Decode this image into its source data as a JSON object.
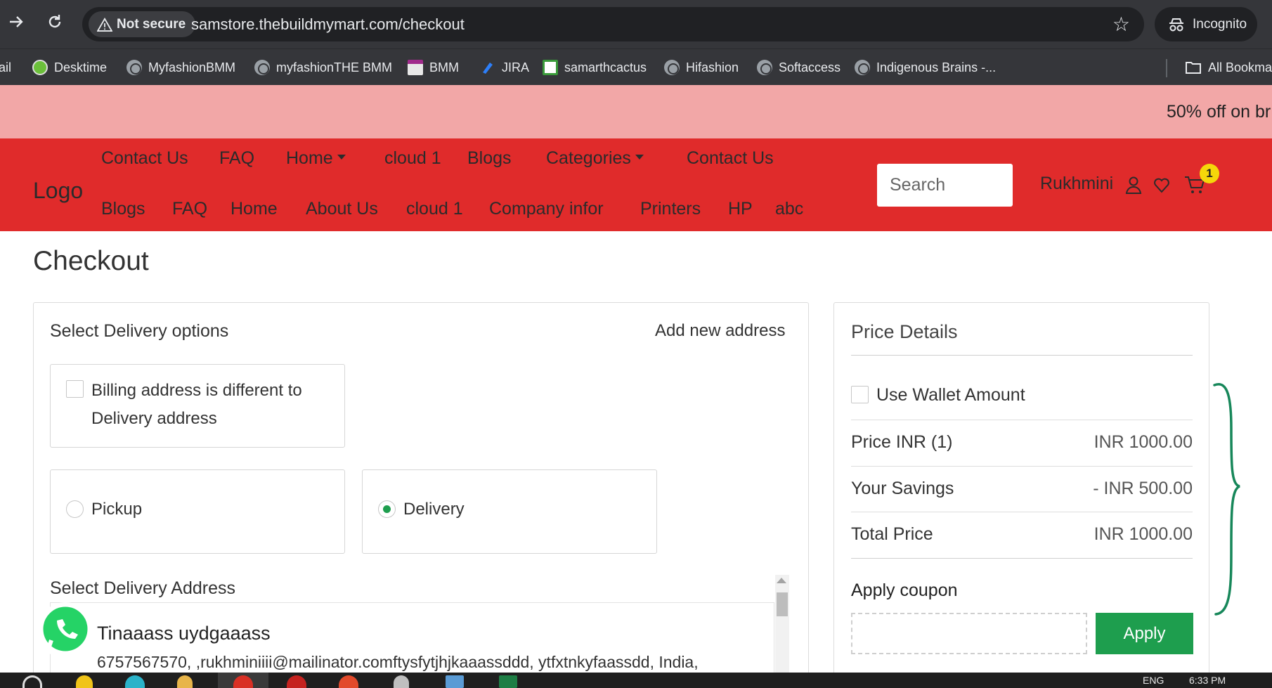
{
  "browser": {
    "security_label": "Not secure",
    "url": "samstore.thebuildmymart.com/checkout",
    "incognito_label": "Incognito",
    "bookmarks": [
      {
        "label": "lail"
      },
      {
        "label": "Desktime"
      },
      {
        "label": "MyfashionBMM"
      },
      {
        "label": "myfashionTHE BMM"
      },
      {
        "label": "BMM"
      },
      {
        "label": "JIRA"
      },
      {
        "label": "samarthcactus"
      },
      {
        "label": "Hifashion"
      },
      {
        "label": "Softaccess"
      },
      {
        "label": "Indigenous Brains -..."
      }
    ],
    "all_bookmarks_label": "All Bookma"
  },
  "promo": {
    "text": "50% off on br",
    "bg_color": "#f2a7a7"
  },
  "header": {
    "bg_color": "#e02b2b",
    "logo": "Logo",
    "menu_top": [
      {
        "label": "Contact Us",
        "dropdown": false
      },
      {
        "label": "FAQ",
        "dropdown": false
      },
      {
        "label": "Home",
        "dropdown": true
      },
      {
        "label": "cloud 1",
        "dropdown": false
      },
      {
        "label": "Blogs",
        "dropdown": false
      },
      {
        "label": "Categories",
        "dropdown": true
      },
      {
        "label": "Contact Us",
        "dropdown": false
      }
    ],
    "menu_bottom": [
      {
        "label": "Blogs"
      },
      {
        "label": "FAQ"
      },
      {
        "label": "Home"
      },
      {
        "label": "About Us"
      },
      {
        "label": "cloud 1"
      },
      {
        "label": "Company infor"
      },
      {
        "label": "Printers"
      },
      {
        "label": "HP"
      },
      {
        "label": "abc"
      }
    ],
    "search_placeholder": "Search",
    "user_name": "Rukhmini",
    "cart_count": "1",
    "badge_color": "#f5d70a"
  },
  "checkout": {
    "title": "Checkout",
    "delivery_options_title": "Select Delivery options",
    "add_new_address": "Add new address",
    "billing_checkbox_label": "Billing address is different to Delivery address",
    "billing_checked": false,
    "method_options": [
      {
        "label": "Pickup",
        "selected": false
      },
      {
        "label": "Delivery",
        "selected": true
      }
    ],
    "address_title": "Select Delivery Address",
    "addresses": [
      {
        "name": "Tinaaass uydgaaass",
        "details": "6757567570, ,rukhminiiii@mailinator.comftysfytjhjkaaassddd, ytfxtnkyfaassdd, India,"
      }
    ]
  },
  "price_details": {
    "title": "Price Details",
    "wallet_label": "Use Wallet Amount",
    "wallet_checked": false,
    "rows": [
      {
        "label": "Price INR (1)",
        "value": "INR 1000.00"
      },
      {
        "label": "Your Savings",
        "value": "- INR 500.00"
      },
      {
        "label": "Total Price",
        "value": "INR 1000.00"
      }
    ],
    "coupon_label": "Apply coupon",
    "coupon_value": "",
    "apply_label": "Apply",
    "accent_color": "#1e9e4e"
  },
  "taskbar": {
    "lang": "ENG",
    "time": "6:33 PM"
  }
}
